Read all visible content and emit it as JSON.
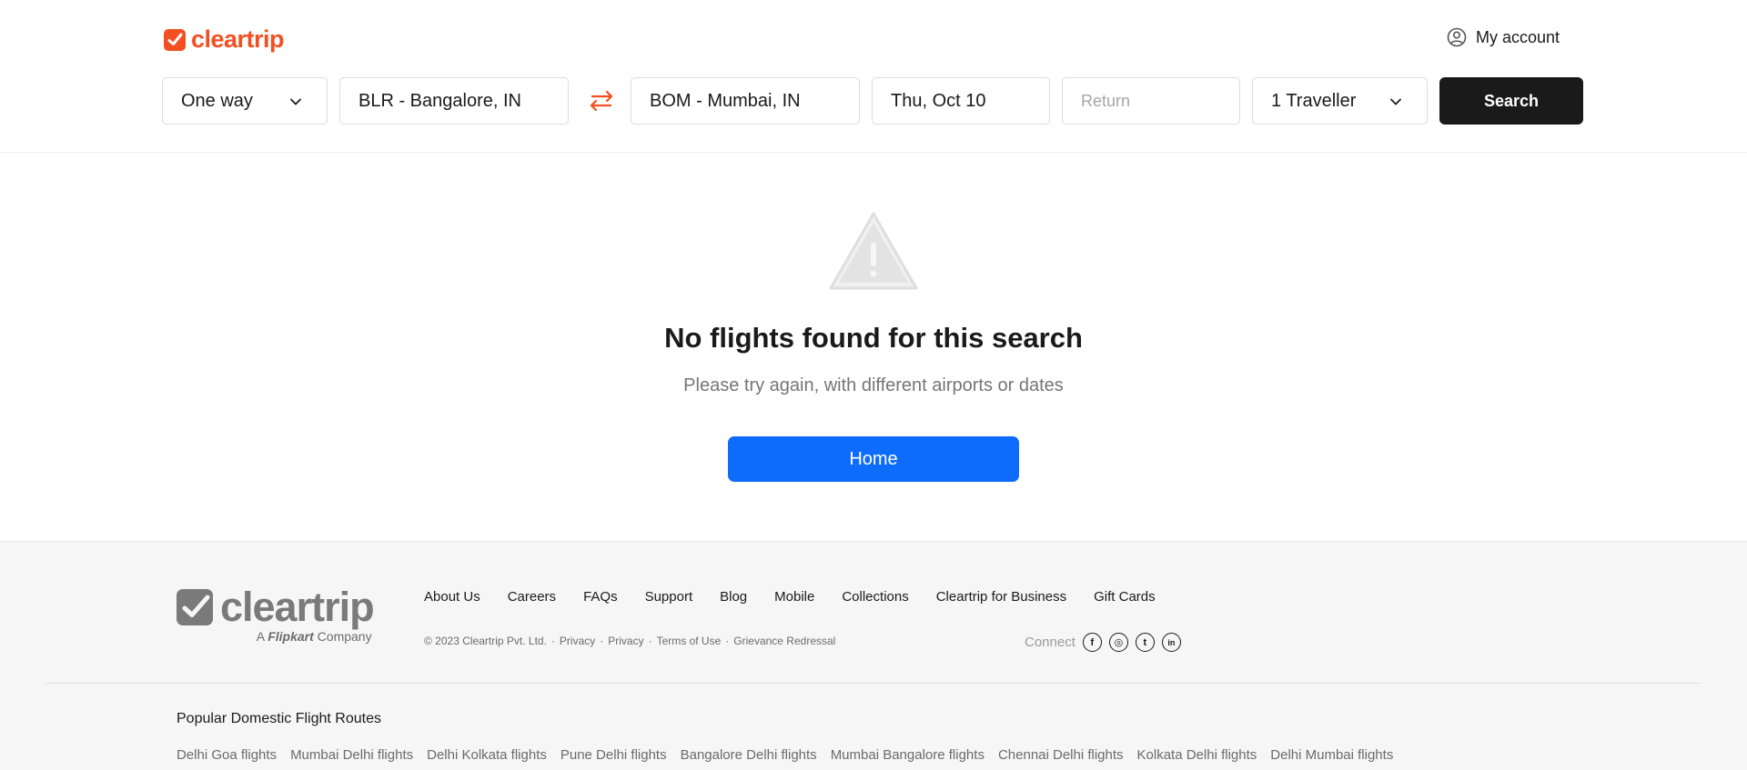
{
  "brand": {
    "name": "cleartrip",
    "color": "#f25022"
  },
  "header": {
    "account_label": "My account",
    "account_icon": "user-circle-icon"
  },
  "search": {
    "trip_type": "One way",
    "from": "BLR - Bangalore, IN",
    "to": "BOM - Mumbai, IN",
    "depart": "Thu, Oct 10",
    "return_placeholder": "Return",
    "travellers": "1 Traveller",
    "search_label": "Search",
    "swap_icon": "swap-arrows-icon"
  },
  "main": {
    "icon": "warning-triangle-icon",
    "title": "No flights found for this search",
    "subtitle": "Please try again, with different airports or dates",
    "home_label": "Home",
    "home_color": "#0e6cfd"
  },
  "footer": {
    "logo_text": "cleartrip",
    "logo_sub_a": "A",
    "logo_sub_brand": "Flipkart",
    "logo_sub_b": "Company",
    "links": [
      "About Us",
      "Careers",
      "FAQs",
      "Support",
      "Blog",
      "Mobile",
      "Collections",
      "Cleartrip for Business",
      "Gift Cards"
    ],
    "copyright": "© 2023 Cleartrip Pvt. Ltd.",
    "legal_links": [
      "Privacy",
      "Privacy",
      "Terms of Use",
      "Grievance Redressal"
    ],
    "connect_label": "Connect",
    "social": [
      {
        "name": "facebook-icon",
        "glyph": "f"
      },
      {
        "name": "instagram-icon",
        "glyph": "◎"
      },
      {
        "name": "twitter-icon",
        "glyph": "t"
      },
      {
        "name": "linkedin-icon",
        "glyph": "in"
      }
    ],
    "routes_heading": "Popular Domestic Flight Routes",
    "routes": [
      "Delhi Goa flights",
      "Mumbai Delhi flights",
      "Delhi Kolkata flights",
      "Pune Delhi flights",
      "Bangalore Delhi flights",
      "Mumbai Bangalore flights",
      "Chennai Delhi flights",
      "Kolkata Delhi flights",
      "Delhi Mumbai flights"
    ]
  }
}
